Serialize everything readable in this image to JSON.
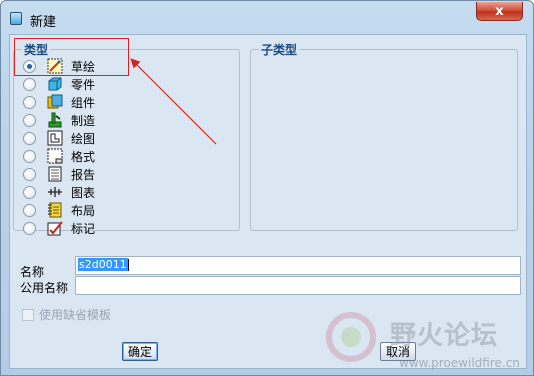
{
  "window": {
    "title": "新建",
    "close_symbol": "x"
  },
  "type_group": {
    "title": "类型",
    "selected": "草绘",
    "items": [
      {
        "label": "草绘",
        "icon": "sketch-icon"
      },
      {
        "label": "零件",
        "icon": "part-icon"
      },
      {
        "label": "组件",
        "icon": "assembly-icon"
      },
      {
        "label": "制造",
        "icon": "manufacturing-icon"
      },
      {
        "label": "绘图",
        "icon": "drawing-icon"
      },
      {
        "label": "格式",
        "icon": "format-icon"
      },
      {
        "label": "报告",
        "icon": "report-icon"
      },
      {
        "label": "图表",
        "icon": "diagram-icon"
      },
      {
        "label": "布局",
        "icon": "layout-icon"
      },
      {
        "label": "标记",
        "icon": "markup-icon"
      }
    ]
  },
  "subtype_group": {
    "title": "子类型"
  },
  "name_field": {
    "label": "名称",
    "value": "s2d0011"
  },
  "common_name_field": {
    "label": "公用名称",
    "value": ""
  },
  "use_default_template": {
    "label": "使用缺省模板",
    "checked": false,
    "enabled": false
  },
  "buttons": {
    "ok": "确定",
    "cancel": "取消"
  },
  "annotation": {
    "color": "#e02020"
  },
  "watermark": {
    "text": "野火论坛",
    "url": "www.proewildfire.cn"
  },
  "colors": {
    "accent": "#2b5e9e",
    "selection": "#3399ff",
    "group_title": "#1b4a83"
  }
}
